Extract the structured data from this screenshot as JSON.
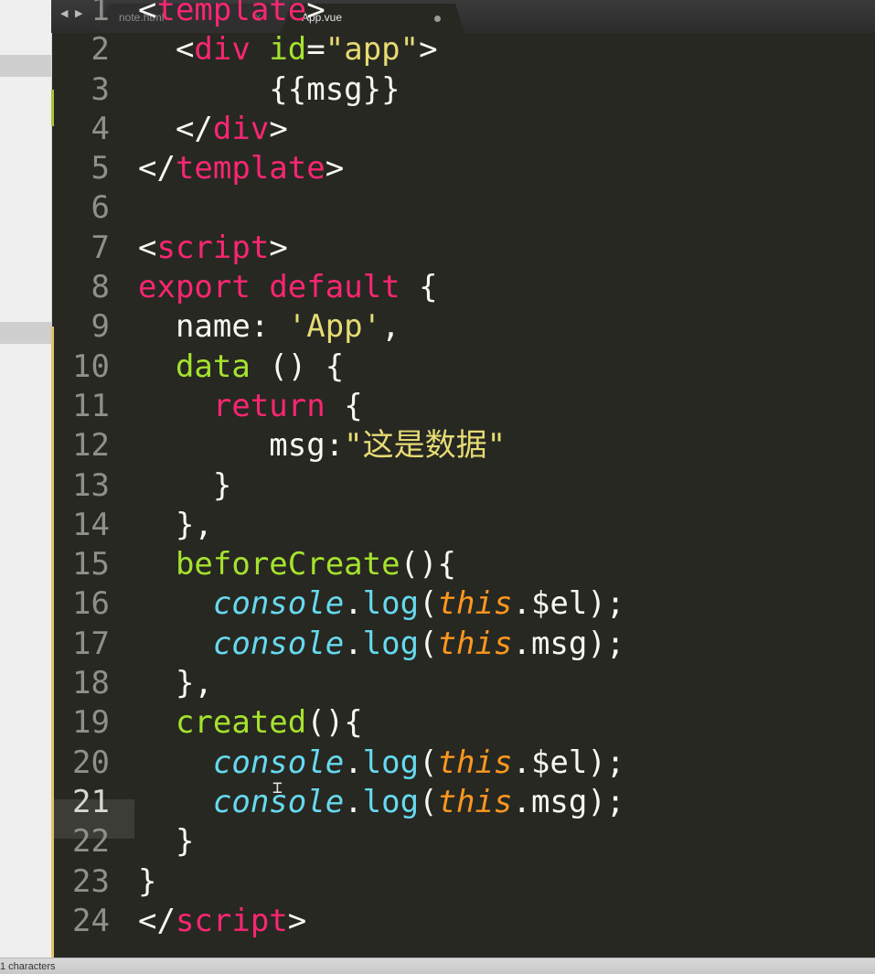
{
  "tabs": [
    {
      "label": "note.html",
      "close_icon": "×",
      "active": false
    },
    {
      "label": "App.vue",
      "active": true,
      "state": "unsaved-dot"
    }
  ],
  "nav": {
    "arrows": "◀ ▶"
  },
  "editor": {
    "current_line": 21,
    "lines": [
      {
        "n": "1",
        "tokens": [
          [
            "t-plain",
            "<"
          ],
          [
            "t-tag",
            "template"
          ],
          [
            "t-plain",
            ">"
          ]
        ]
      },
      {
        "n": "2",
        "tokens": [
          [
            "t-plain",
            "  <"
          ],
          [
            "t-tag",
            "div"
          ],
          [
            "t-plain",
            " "
          ],
          [
            "t-attr",
            "id"
          ],
          [
            "t-plain",
            "="
          ],
          [
            "t-str",
            "\"app\""
          ],
          [
            "t-plain",
            ">"
          ]
        ]
      },
      {
        "n": "3",
        "tokens": [
          [
            "t-plain",
            "       {{msg}}"
          ]
        ]
      },
      {
        "n": "4",
        "tokens": [
          [
            "t-plain",
            "  </"
          ],
          [
            "t-tag",
            "div"
          ],
          [
            "t-plain",
            ">"
          ]
        ]
      },
      {
        "n": "5",
        "tokens": [
          [
            "t-plain",
            "</"
          ],
          [
            "t-tag",
            "template"
          ],
          [
            "t-plain",
            ">"
          ]
        ]
      },
      {
        "n": "6",
        "tokens": []
      },
      {
        "n": "7",
        "tokens": [
          [
            "t-plain",
            "<"
          ],
          [
            "t-tag",
            "script"
          ],
          [
            "t-plain",
            ">"
          ]
        ]
      },
      {
        "n": "8",
        "tokens": [
          [
            "t-kw",
            "export"
          ],
          [
            "t-plain",
            " "
          ],
          [
            "t-kw",
            "default"
          ],
          [
            "t-plain",
            " {"
          ]
        ]
      },
      {
        "n": "9",
        "tokens": [
          [
            "t-plain",
            "  name: "
          ],
          [
            "t-str",
            "'App'"
          ],
          [
            "t-plain",
            ","
          ]
        ]
      },
      {
        "n": "10",
        "tokens": [
          [
            "t-plain",
            "  "
          ],
          [
            "t-fn",
            "data"
          ],
          [
            "t-plain",
            " () {"
          ]
        ]
      },
      {
        "n": "11",
        "tokens": [
          [
            "t-plain",
            "    "
          ],
          [
            "t-kw",
            "return"
          ],
          [
            "t-plain",
            " {"
          ]
        ]
      },
      {
        "n": "12",
        "tokens": [
          [
            "t-plain",
            "       msg:"
          ],
          [
            "t-str",
            "\"这是数据\""
          ]
        ]
      },
      {
        "n": "13",
        "tokens": [
          [
            "t-plain",
            "    }"
          ]
        ]
      },
      {
        "n": "14",
        "tokens": [
          [
            "t-plain",
            "  },"
          ]
        ]
      },
      {
        "n": "15",
        "tokens": [
          [
            "t-plain",
            "  "
          ],
          [
            "t-fn",
            "beforeCreate"
          ],
          [
            "t-plain",
            "(){"
          ]
        ]
      },
      {
        "n": "16",
        "tokens": [
          [
            "t-plain",
            "    "
          ],
          [
            "t-cls",
            "console"
          ],
          [
            "t-plain",
            "."
          ],
          [
            "t-meth",
            "log"
          ],
          [
            "t-plain",
            "("
          ],
          [
            "t-this",
            "this"
          ],
          [
            "t-plain",
            ".$el);"
          ]
        ]
      },
      {
        "n": "17",
        "tokens": [
          [
            "t-plain",
            "    "
          ],
          [
            "t-cls",
            "console"
          ],
          [
            "t-plain",
            "."
          ],
          [
            "t-meth",
            "log"
          ],
          [
            "t-plain",
            "("
          ],
          [
            "t-this",
            "this"
          ],
          [
            "t-plain",
            ".msg);"
          ]
        ]
      },
      {
        "n": "18",
        "tokens": [
          [
            "t-plain",
            "  },"
          ]
        ]
      },
      {
        "n": "19",
        "tokens": [
          [
            "t-plain",
            "  "
          ],
          [
            "t-fn",
            "created"
          ],
          [
            "t-plain",
            "(){"
          ]
        ]
      },
      {
        "n": "20",
        "tokens": [
          [
            "t-plain",
            "    "
          ],
          [
            "t-cls",
            "console"
          ],
          [
            "t-plain",
            "."
          ],
          [
            "t-meth",
            "log"
          ],
          [
            "t-plain",
            "("
          ],
          [
            "t-this",
            "this"
          ],
          [
            "t-plain",
            ".$el);"
          ]
        ]
      },
      {
        "n": "21",
        "tokens": [
          [
            "t-plain",
            "    "
          ],
          [
            "t-cls",
            "console"
          ],
          [
            "t-plain",
            "."
          ],
          [
            "t-meth",
            "log"
          ],
          [
            "t-plain",
            "("
          ],
          [
            "t-this",
            "this"
          ],
          [
            "t-plain",
            ".msg);"
          ]
        ]
      },
      {
        "n": "22",
        "tokens": [
          [
            "t-plain",
            "  }"
          ]
        ]
      },
      {
        "n": "23",
        "tokens": [
          [
            "t-plain",
            "}"
          ]
        ]
      },
      {
        "n": "24",
        "tokens": [
          [
            "t-plain",
            "</"
          ],
          [
            "t-tag",
            "script"
          ],
          [
            "t-plain",
            ">"
          ]
        ]
      }
    ]
  },
  "status": {
    "text": "1 characters"
  },
  "colors": {
    "background": "#272822",
    "tag": "#f92672",
    "attribute": "#a6e22e",
    "string": "#e6db74",
    "builtin": "#66d9ef",
    "this": "#fd971f",
    "foreground": "#f8f8f2",
    "gutter_text": "#8f908a"
  }
}
